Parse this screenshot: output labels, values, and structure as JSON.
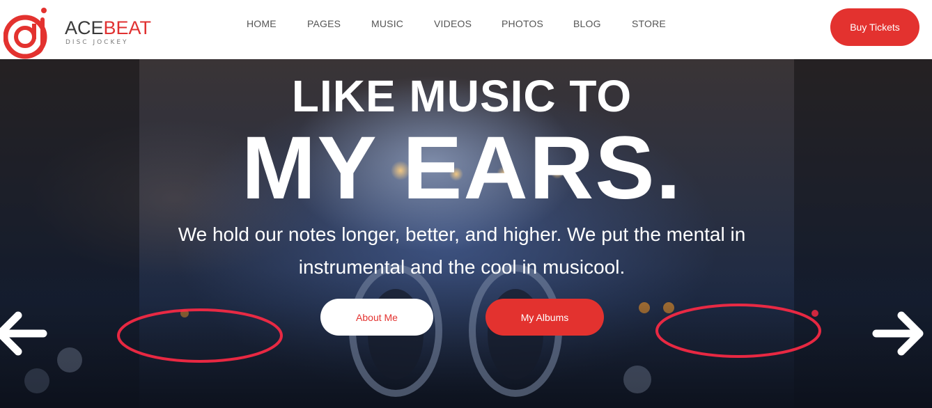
{
  "brand": {
    "name_part1": "ACE",
    "name_part2": "BEAT",
    "tagline": "DISC JOCKEY",
    "primary_color": "#e3322f",
    "logo_icon": "dj-monogram-icon"
  },
  "nav": {
    "items": [
      {
        "label": "HOME"
      },
      {
        "label": "PAGES"
      },
      {
        "label": "MUSIC"
      },
      {
        "label": "VIDEOS"
      },
      {
        "label": "PHOTOS"
      },
      {
        "label": "BLOG"
      },
      {
        "label": "STORE"
      }
    ],
    "cta_label": "Buy Tickets"
  },
  "hero": {
    "title_line1": "LIKE MUSIC TO",
    "title_line2": "MY EARS.",
    "description": "We hold our notes longer, better, and higher. We put the mental in instrumental and the cool in musicool.",
    "primary_button": "About Me",
    "secondary_button": "My Albums",
    "prev_icon": "arrow-left-icon",
    "next_icon": "arrow-right-icon"
  }
}
